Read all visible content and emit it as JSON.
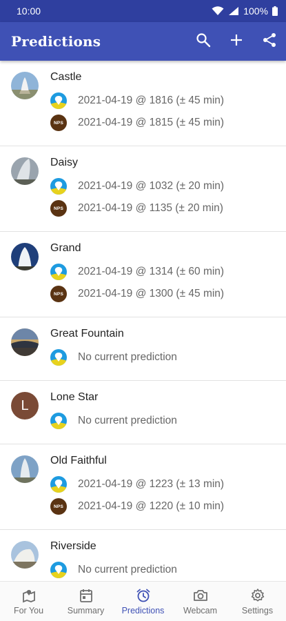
{
  "status_bar": {
    "time": "10:00",
    "battery": "100%"
  },
  "app_bar": {
    "title": "Predictions",
    "actions": [
      {
        "name": "search",
        "icon": "search-icon"
      },
      {
        "name": "add",
        "icon": "plus-icon"
      },
      {
        "name": "share",
        "icon": "share-icon"
      }
    ]
  },
  "geysers": [
    {
      "name": "Castle",
      "avatar": "photo",
      "predictions": [
        {
          "source": "geyser-times",
          "text": "2021-04-19 @ 1816 (± 45 min)"
        },
        {
          "source": "nps",
          "label": "NPS",
          "text": "2021-04-19 @ 1815 (± 45 min)"
        }
      ]
    },
    {
      "name": "Daisy",
      "avatar": "photo",
      "predictions": [
        {
          "source": "geyser-times",
          "text": "2021-04-19 @ 1032 (± 20 min)"
        },
        {
          "source": "nps",
          "label": "NPS",
          "text": "2021-04-19 @ 1135 (± 20 min)"
        }
      ]
    },
    {
      "name": "Grand",
      "avatar": "photo",
      "predictions": [
        {
          "source": "geyser-times",
          "text": "2021-04-19 @ 1314 (± 60 min)"
        },
        {
          "source": "nps",
          "label": "NPS",
          "text": "2021-04-19 @ 1300 (± 45 min)"
        }
      ]
    },
    {
      "name": "Great Fountain",
      "avatar": "photo",
      "predictions": [
        {
          "source": "geyser-times",
          "text": "No current prediction"
        }
      ]
    },
    {
      "name": "Lone Star",
      "avatar": "letter",
      "avatar_letter": "L",
      "predictions": [
        {
          "source": "geyser-times",
          "text": "No current prediction"
        }
      ]
    },
    {
      "name": "Old Faithful",
      "avatar": "photo",
      "predictions": [
        {
          "source": "geyser-times",
          "text": "2021-04-19 @ 1223 (± 13 min)"
        },
        {
          "source": "nps",
          "label": "NPS",
          "text": "2021-04-19 @ 1220 (± 10 min)"
        }
      ]
    },
    {
      "name": "Riverside",
      "avatar": "photo",
      "predictions": [
        {
          "source": "geyser-times",
          "text": "No current prediction"
        }
      ]
    }
  ],
  "bottom_nav": [
    {
      "label": "For You",
      "icon": "map-pin-icon",
      "active": false
    },
    {
      "label": "Summary",
      "icon": "calendar-icon",
      "active": false
    },
    {
      "label": "Predictions",
      "icon": "alarm-clock-icon",
      "active": true
    },
    {
      "label": "Webcam",
      "icon": "camera-icon",
      "active": false
    },
    {
      "label": "Settings",
      "icon": "gear-icon",
      "active": false
    }
  ],
  "colors": {
    "status_bar": "#2f3f9f",
    "app_bar": "#3f51b5",
    "active_nav": "#3f51b5",
    "nps_badge": "#5a3312",
    "geyser_times_badge": "#1e9be0"
  }
}
